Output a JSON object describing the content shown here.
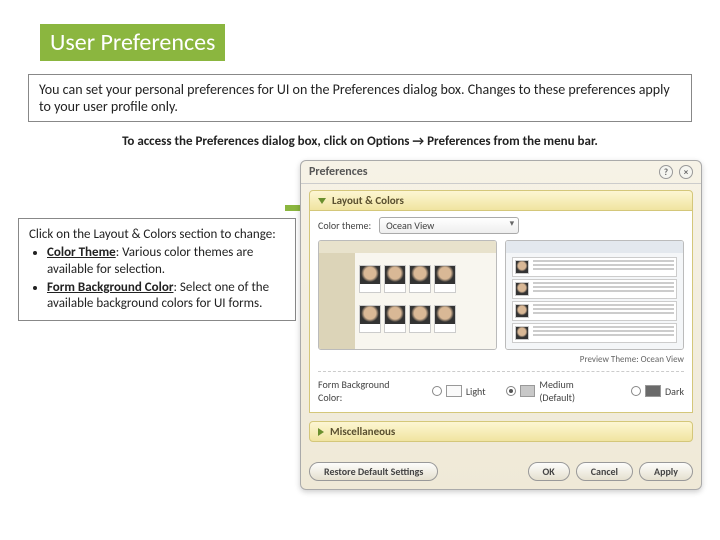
{
  "header": {
    "title": "User Preferences"
  },
  "intro": "You can set your personal preferences for UI on the Preferences dialog box. Changes to these preferences apply to your user profile only.",
  "access_instruction": "To access the Preferences dialog box, click on Options → Preferences from the menu bar.",
  "callout": {
    "lead": "Click on the Layout & Colors section to change:",
    "items": [
      {
        "term": "Color Theme",
        "desc": ": Various color themes are available for selection."
      },
      {
        "term": "Form Background Color",
        "desc": ": Select one of the available background colors for UI forms."
      }
    ]
  },
  "dialog": {
    "title": "Preferences",
    "section_layout_colors": "Layout & Colors",
    "color_theme_label": "Color theme:",
    "color_theme_value": "Ocean View",
    "preview_caption": "Preview Theme: Ocean View",
    "form_bg_label": "Form Background Color:",
    "bg_options": [
      {
        "label": "Light",
        "selected": false,
        "swatch": "light"
      },
      {
        "label": "Medium (Default)",
        "selected": true,
        "swatch": "med"
      },
      {
        "label": "Dark",
        "selected": false,
        "swatch": "dark"
      }
    ],
    "section_misc": "Miscellaneous",
    "buttons": {
      "restore": "Restore Default Settings",
      "ok": "OK",
      "cancel": "Cancel",
      "apply": "Apply"
    }
  }
}
